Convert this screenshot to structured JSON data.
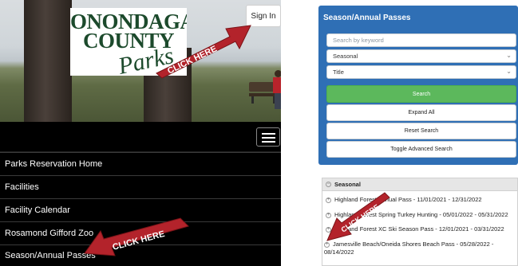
{
  "left": {
    "sign_in": "Sign In",
    "logo": {
      "line1": "ONONDAGA",
      "line2": "COUNTY",
      "line3": "Parks"
    },
    "nav_items": [
      {
        "label": "Parks Reservation Home"
      },
      {
        "label": "Facilities"
      },
      {
        "label": "Facility Calendar"
      },
      {
        "label": "Rosamond Gifford Zoo"
      },
      {
        "label": "Season/Annual Passes"
      }
    ],
    "annotations": {
      "click_here_top": "CLICK HERE",
      "click_here_bottom": "CLICK HERE"
    }
  },
  "right": {
    "panel_title": "Season/Annual Passes",
    "search_placeholder": "Search by keyword",
    "category_select": "Seasonal",
    "sort_select": "Title",
    "search_button": "Search",
    "expand_all_button": "Expand All",
    "reset_search_button": "Reset Search",
    "toggle_advanced_button": "Toggle Advanced Search",
    "section_title": "Seasonal",
    "passes": [
      {
        "label": "Highland Forest Annual Pass - 11/01/2021 - 12/31/2022"
      },
      {
        "label": "Highland Forest Spring Turkey Hunting - 05/01/2022 - 05/31/2022"
      },
      {
        "label": "Highland Forest XC Ski Season Pass - 12/01/2021 - 03/31/2022"
      },
      {
        "label": "Jamesville Beach/Oneida Shores Beach Pass - 05/28/2022 - 08/14/2022"
      }
    ],
    "annotation": "CLICK HERE"
  },
  "colors": {
    "panel_blue": "#2f6fb5",
    "search_green": "#5cb85c",
    "arrow_red": "#b3232b",
    "logo_green": "#1c4a2c"
  }
}
